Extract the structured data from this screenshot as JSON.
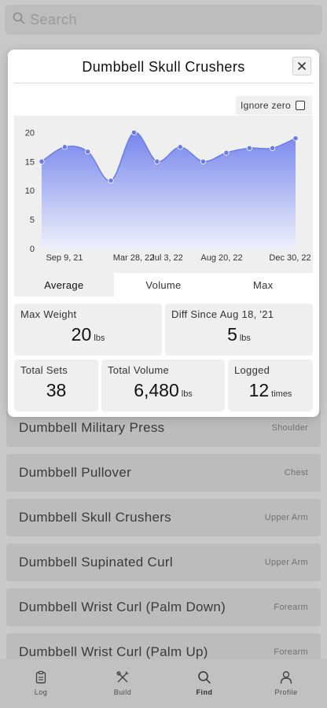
{
  "search": {
    "placeholder": "Search"
  },
  "exercise_list": [
    {
      "name": "Dumbbell Military Press",
      "category": "Shoulder"
    },
    {
      "name": "Dumbbell Pullover",
      "category": "Chest"
    },
    {
      "name": "Dumbbell Skull Crushers",
      "category": "Upper Arm"
    },
    {
      "name": "Dumbbell Supinated Curl",
      "category": "Upper Arm"
    },
    {
      "name": "Dumbbell Wrist Curl (Palm Down)",
      "category": "Forearm"
    },
    {
      "name": "Dumbbell Wrist Curl (Palm Up)",
      "category": "Forearm"
    }
  ],
  "bottom_nav": {
    "items": [
      {
        "label": "Log",
        "icon": "clipboard-icon"
      },
      {
        "label": "Build",
        "icon": "wrench-pencil-icon"
      },
      {
        "label": "Find",
        "icon": "search-icon"
      },
      {
        "label": "Profile",
        "icon": "person-icon"
      }
    ],
    "active": "Find"
  },
  "modal": {
    "title": "Dumbbell Skull Crushers",
    "ignore_zero_label": "Ignore zero",
    "ignore_zero_checked": false,
    "tabs": [
      "Average",
      "Volume",
      "Max"
    ],
    "active_tab": "Average",
    "stats": {
      "max_weight": {
        "label": "Max Weight",
        "value": "20",
        "unit": "lbs"
      },
      "diff_since": {
        "label": "Diff Since Aug 18, '21",
        "value": "5",
        "unit": "lbs"
      },
      "total_sets": {
        "label": "Total Sets",
        "value": "38"
      },
      "total_volume": {
        "label": "Total Volume",
        "value": "6,480",
        "unit": "lbs"
      },
      "logged": {
        "label": "Logged",
        "value": "12",
        "unit": "times"
      }
    }
  },
  "chart_data": {
    "type": "area",
    "x_tick_labels": [
      "Sep 9, 21",
      "Mar 28, 22",
      "Jul 3, 22",
      "Aug 20, 22",
      "Dec 30, 22"
    ],
    "y_ticks": [
      0,
      5,
      10,
      15,
      20
    ],
    "ylim": [
      0,
      21
    ],
    "values": [
      15,
      17.5,
      16.7,
      11.7,
      20,
      15,
      17.5,
      15,
      16.5,
      17.3,
      17.3,
      19
    ],
    "grid": false,
    "colors": {
      "line": "#6b7ce6",
      "point": "#6b7ce6",
      "fill_top": "#7585ec",
      "fill_bottom": "#eef0fb"
    }
  }
}
